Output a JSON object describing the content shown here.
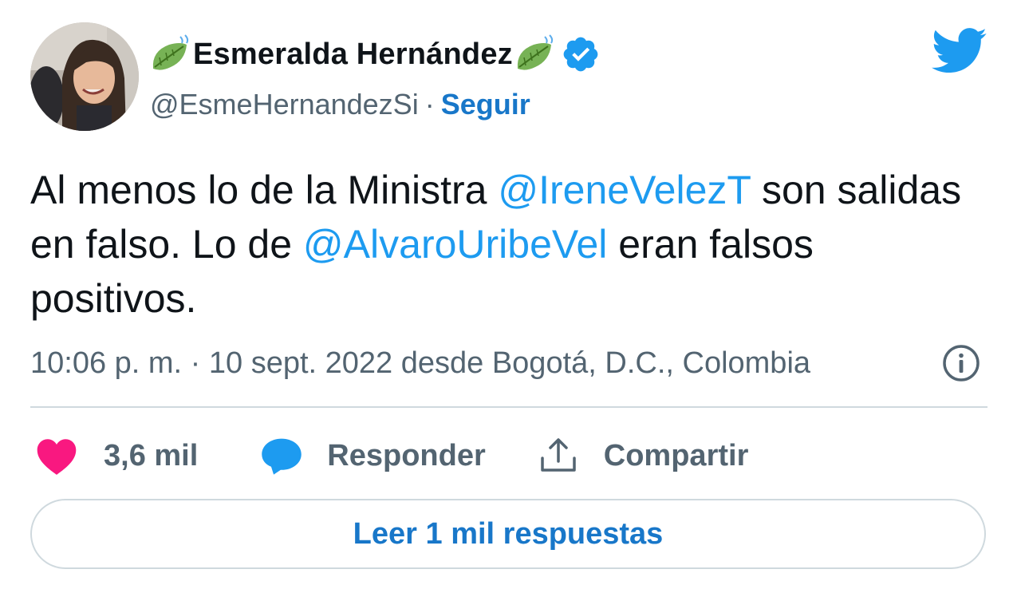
{
  "author": {
    "display_name": "Esmeralda Hernández",
    "handle": "@EsmeHernandezSi",
    "separator": "·",
    "follow_label": "Seguir",
    "verified": true,
    "name_decoration_icon": "leaf-fluttering-icon"
  },
  "tweet": {
    "segments": [
      {
        "text": "Al menos lo de la Ministra ",
        "type": "text"
      },
      {
        "text": "@IreneVelezT",
        "type": "mention"
      },
      {
        "text": " son salidas en falso. Lo de ",
        "type": "text"
      },
      {
        "text": "@AlvaroUribeVel",
        "type": "mention"
      },
      {
        "text": " eran falsos positivos.",
        "type": "text"
      }
    ],
    "timestamp": "10:06 p. m. · 10 sept. 2022 desde Bogotá, D.C., Colombia"
  },
  "actions": {
    "like_count": "3,6 mil",
    "reply_label": "Responder",
    "share_label": "Compartir"
  },
  "read_replies_label": "Leer 1 mil respuestas",
  "colors": {
    "link_blue": "#1d9bf0",
    "bold_link_blue": "#1877c9",
    "heart_pink": "#f91880",
    "secondary_gray": "#536471",
    "divider": "#cfd9de",
    "twitter_blue": "#1d9bf0"
  },
  "icons": {
    "brand": "twitter-bird-icon",
    "info": "info-icon",
    "like": "heart-icon",
    "reply": "speech-bubble-icon",
    "share": "share-upload-icon",
    "verified": "verified-badge-icon"
  }
}
